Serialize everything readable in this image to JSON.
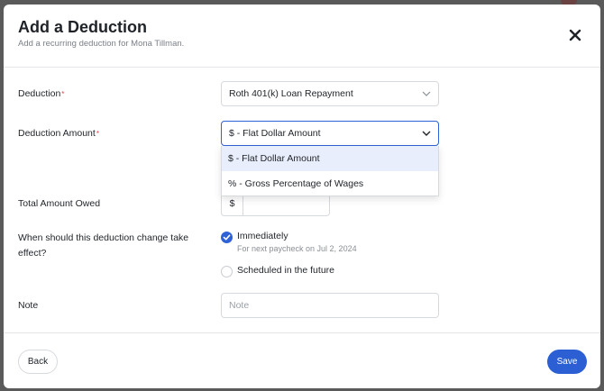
{
  "modal": {
    "title": "Add a Deduction",
    "subtitle": "Add a recurring deduction for Mona Tillman."
  },
  "form": {
    "deduction": {
      "label": "Deduction",
      "required_mark": "*",
      "value": "Roth 401(k) Loan Repayment"
    },
    "deduction_amount": {
      "label": "Deduction Amount",
      "required_mark": "*",
      "value": "$ - Flat Dollar Amount",
      "options": [
        "$ - Flat Dollar Amount",
        "% - Gross Percentage of Wages"
      ],
      "highlighted_option": 0
    },
    "total_amount_owed": {
      "label": "Total Amount Owed",
      "prefix": "$",
      "value": ""
    },
    "effective": {
      "label": "When should this deduction change take effect?",
      "options": [
        {
          "label": "Immediately",
          "help": "For next paycheck on Jul 2, 2024",
          "checked": true
        },
        {
          "label": "Scheduled in the future",
          "help": "",
          "checked": false
        }
      ]
    },
    "note": {
      "label": "Note",
      "placeholder": "Note",
      "value": ""
    }
  },
  "footer": {
    "back_label": "Back",
    "save_label": "Save"
  },
  "colors": {
    "accent": "#2c5fd3",
    "required": "#e0424f",
    "highlight": "#e8eefb"
  },
  "icons": {
    "close": "close-icon",
    "chevron": "chevron-down-icon",
    "check": "check-icon"
  }
}
